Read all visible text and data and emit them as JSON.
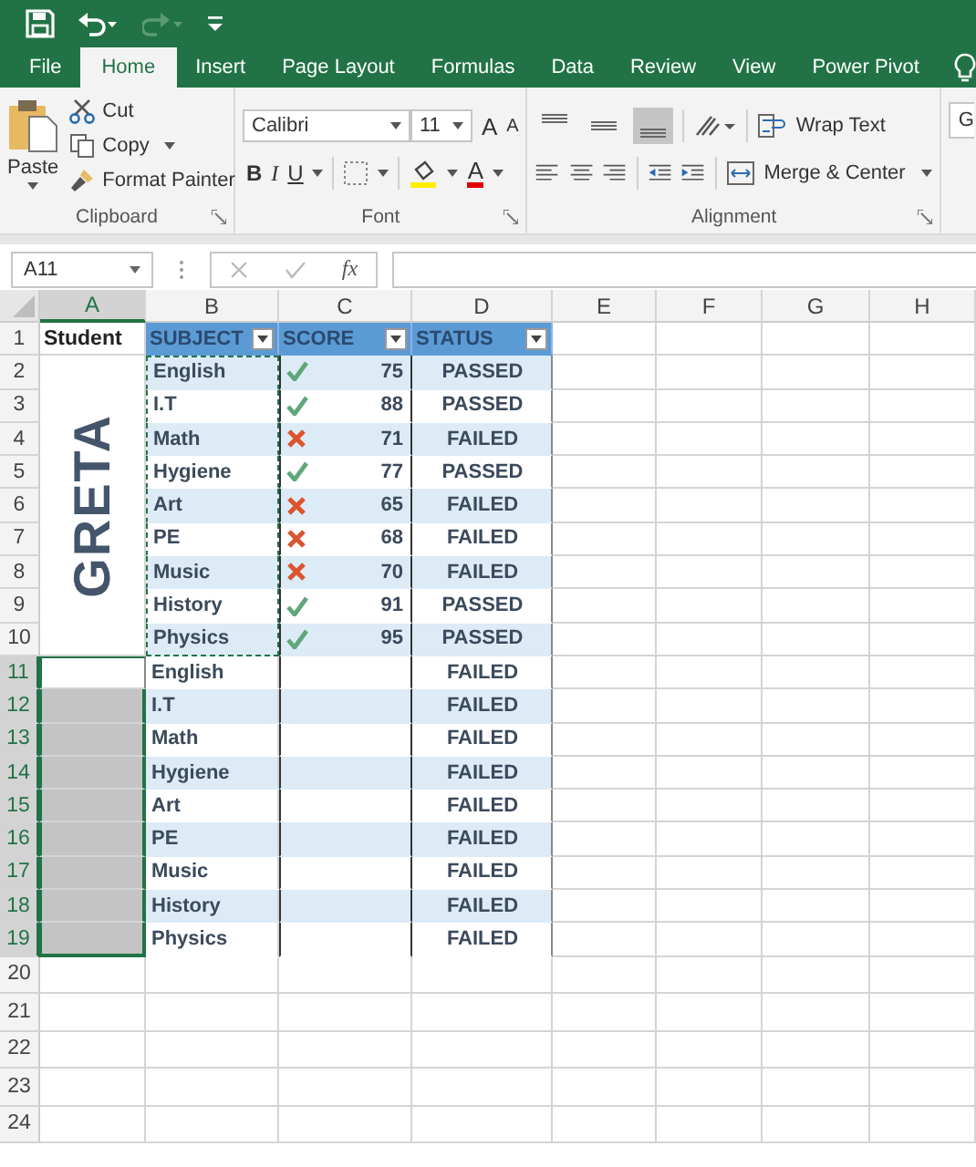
{
  "tabs": [
    {
      "label": "File",
      "selected": false
    },
    {
      "label": "Home",
      "selected": true
    },
    {
      "label": "Insert",
      "selected": false
    },
    {
      "label": "Page Layout",
      "selected": false
    },
    {
      "label": "Formulas",
      "selected": false
    },
    {
      "label": "Data",
      "selected": false
    },
    {
      "label": "Review",
      "selected": false
    },
    {
      "label": "View",
      "selected": false
    },
    {
      "label": "Power Pivot",
      "selected": false
    }
  ],
  "ribbon": {
    "clipboard": {
      "paste": "Paste",
      "cut": "Cut",
      "copy": "Copy",
      "format_painter": "Format Painter",
      "label": "Clipboard"
    },
    "font": {
      "family": "Calibri",
      "size": "11",
      "grow": "A",
      "shrink": "A",
      "bold": "B",
      "italic": "I",
      "underline": "U",
      "font_color": "A",
      "label": "Font"
    },
    "alignment": {
      "vertical": [
        {
          "selected": false
        },
        {
          "selected": false
        },
        {
          "selected": true
        }
      ],
      "wrap_text": "Wrap Text",
      "merge": "Merge & Center",
      "label": "Alignment"
    },
    "number_format": "G"
  },
  "name_box": "A11",
  "fx": "fx",
  "sheet": {
    "columns": [
      {
        "label": "A",
        "selected": true
      },
      {
        "label": "B",
        "selected": false
      },
      {
        "label": "C",
        "selected": false
      },
      {
        "label": "D",
        "selected": false
      },
      {
        "label": "E",
        "selected": false
      },
      {
        "label": "F",
        "selected": false
      },
      {
        "label": "G",
        "selected": false
      },
      {
        "label": "H",
        "selected": false
      }
    ],
    "row_headers": [
      {
        "label": "1",
        "selected": false
      },
      {
        "label": "2",
        "selected": false
      },
      {
        "label": "3",
        "selected": false
      },
      {
        "label": "4",
        "selected": false
      },
      {
        "label": "5",
        "selected": false
      },
      {
        "label": "6",
        "selected": false
      },
      {
        "label": "7",
        "selected": false
      },
      {
        "label": "8",
        "selected": false
      },
      {
        "label": "9",
        "selected": false
      },
      {
        "label": "10",
        "selected": false
      },
      {
        "label": "11",
        "selected": true
      },
      {
        "label": "12",
        "selected": true
      },
      {
        "label": "13",
        "selected": true
      },
      {
        "label": "14",
        "selected": true
      },
      {
        "label": "15",
        "selected": true
      },
      {
        "label": "16",
        "selected": true
      },
      {
        "label": "17",
        "selected": true
      },
      {
        "label": "18",
        "selected": true
      },
      {
        "label": "19",
        "selected": true
      },
      {
        "label": "20",
        "selected": false
      },
      {
        "label": "21",
        "selected": false
      },
      {
        "label": "22",
        "selected": false
      },
      {
        "label": "23",
        "selected": false
      },
      {
        "label": "24",
        "selected": false
      }
    ]
  },
  "student_header": "Student",
  "student_name": "GRETA",
  "student_cells": [
    {
      "selected": true,
      "active": true
    },
    {
      "selected": true,
      "active": false
    },
    {
      "selected": true,
      "active": false
    },
    {
      "selected": true,
      "active": false
    },
    {
      "selected": true,
      "active": false
    },
    {
      "selected": true,
      "active": false
    },
    {
      "selected": true,
      "active": false
    },
    {
      "selected": true,
      "active": false
    },
    {
      "selected": true,
      "active": false
    }
  ],
  "table": {
    "headers": [
      "SUBJECT",
      "SCORE",
      "STATUS"
    ],
    "records": [
      {
        "subject": "English",
        "passed": true,
        "score": "75",
        "status": "PASSED",
        "copied": true
      },
      {
        "subject": "I.T",
        "passed": true,
        "score": "88",
        "status": "PASSED",
        "copied": true
      },
      {
        "subject": "Math",
        "passed": false,
        "score": "71",
        "status": "FAILED",
        "copied": true
      },
      {
        "subject": "Hygiene",
        "passed": true,
        "score": "77",
        "status": "PASSED",
        "copied": true
      },
      {
        "subject": "Art",
        "passed": false,
        "score": "65",
        "status": "FAILED",
        "copied": true
      },
      {
        "subject": "PE",
        "passed": false,
        "score": "68",
        "status": "FAILED",
        "copied": true
      },
      {
        "subject": "Music",
        "passed": false,
        "score": "70",
        "status": "FAILED",
        "copied": true
      },
      {
        "subject": "History",
        "passed": true,
        "score": "91",
        "status": "PASSED",
        "copied": true
      },
      {
        "subject": "Physics",
        "passed": true,
        "score": "95",
        "status": "PASSED",
        "copied": true
      },
      {
        "subject": "English",
        "status": "FAILED",
        "copied": false
      },
      {
        "subject": "I.T",
        "status": "FAILED",
        "copied": false
      },
      {
        "subject": "Math",
        "status": "FAILED",
        "copied": false
      },
      {
        "subject": "Hygiene",
        "status": "FAILED",
        "copied": false
      },
      {
        "subject": "Art",
        "status": "FAILED",
        "copied": false
      },
      {
        "subject": "PE",
        "status": "FAILED",
        "copied": false
      },
      {
        "subject": "Music",
        "status": "FAILED",
        "copied": false
      },
      {
        "subject": "History",
        "status": "FAILED",
        "copied": false
      },
      {
        "subject": "Physics",
        "status": "FAILED",
        "copied": false
      }
    ]
  }
}
